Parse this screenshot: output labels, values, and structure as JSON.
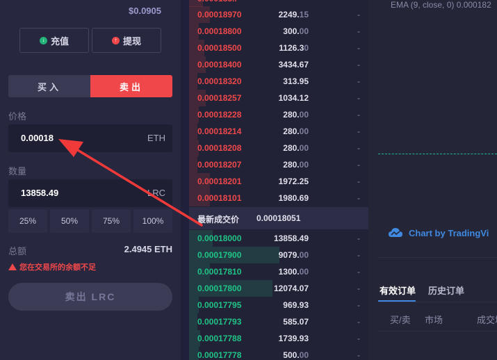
{
  "balance_value": "$0.0905",
  "deposit": {
    "label": "充值",
    "icon": "arrow-down-icon",
    "color": "#22b27a"
  },
  "withdraw": {
    "label": "提现",
    "icon": "arrow-up-icon",
    "color": "#f0484a"
  },
  "side_tabs": {
    "buy": "买入",
    "sell": "卖出",
    "active": "sell"
  },
  "price": {
    "label": "价格",
    "value": "0.00018",
    "unit": "ETH"
  },
  "amount": {
    "label": "数量",
    "value": "13858.49",
    "unit": "LRC"
  },
  "percent_buttons": [
    "25%",
    "50%",
    "75%",
    "100%"
  ],
  "total": {
    "label": "总额",
    "value": "2.4945 ETH"
  },
  "warning": "您在交易所的余额不足",
  "submit_label": "卖出  LRC",
  "asks": [
    {
      "price": "0.00018970",
      "amount": "2249.",
      "amount_dim": "15",
      "depth": "-"
    },
    {
      "price": "0.00018800",
      "amount": "300.",
      "amount_dim": "00",
      "depth": "-"
    },
    {
      "price": "0.00018500",
      "amount": "1126.3",
      "amount_dim": "0",
      "depth": "-"
    },
    {
      "price": "0.00018400",
      "amount": "3434.67",
      "amount_dim": "",
      "depth": "-"
    },
    {
      "price": "0.00018320",
      "amount": "313.95",
      "amount_dim": "",
      "depth": "-"
    },
    {
      "price": "0.00018257",
      "amount": "1034.12",
      "amount_dim": "",
      "depth": "-"
    },
    {
      "price": "0.00018228",
      "amount": "280.",
      "amount_dim": "00",
      "depth": "-"
    },
    {
      "price": "0.00018214",
      "amount": "280.",
      "amount_dim": "00",
      "depth": "-"
    },
    {
      "price": "0.00018208",
      "amount": "280.",
      "amount_dim": "00",
      "depth": "-"
    },
    {
      "price": "0.00018207",
      "amount": "280.",
      "amount_dim": "00",
      "depth": "-"
    },
    {
      "price": "0.00018201",
      "amount": "1972.25",
      "amount_dim": "",
      "depth": "-"
    },
    {
      "price": "0.00018101",
      "amount": "1980.69",
      "amount_dim": "",
      "depth": "-"
    }
  ],
  "latest_trade": {
    "label": "最新成交价",
    "value": "0.00018051"
  },
  "bids": [
    {
      "price": "0.00018000",
      "amount": "13858.49",
      "amount_dim": "",
      "depth": "-"
    },
    {
      "price": "0.00017900",
      "amount": "9079.",
      "amount_dim": "00",
      "depth": "-"
    },
    {
      "price": "0.00017810",
      "amount": "1300.",
      "amount_dim": "00",
      "depth": "-"
    },
    {
      "price": "0.00017800",
      "amount": "12074.07",
      "amount_dim": "",
      "depth": "-"
    },
    {
      "price": "0.00017795",
      "amount": "969.93",
      "amount_dim": "",
      "depth": "-"
    },
    {
      "price": "0.00017793",
      "amount": "585.07",
      "amount_dim": "",
      "depth": "-"
    },
    {
      "price": "0.00017788",
      "amount": "1739.93",
      "amount_dim": "",
      "depth": "-"
    },
    {
      "price": "0.00017778",
      "amount": "500.",
      "amount_dim": "00",
      "depth": "-"
    }
  ],
  "chart": {
    "ema_label": "EMA (9, close, 0)  0.000182",
    "tradingview_label": "Chart by TradingVi"
  },
  "orders": {
    "tabs": [
      "有效订单",
      "历史订单"
    ],
    "active_tab": 0,
    "columns": [
      "买/卖",
      "市场",
      "成交均"
    ]
  }
}
